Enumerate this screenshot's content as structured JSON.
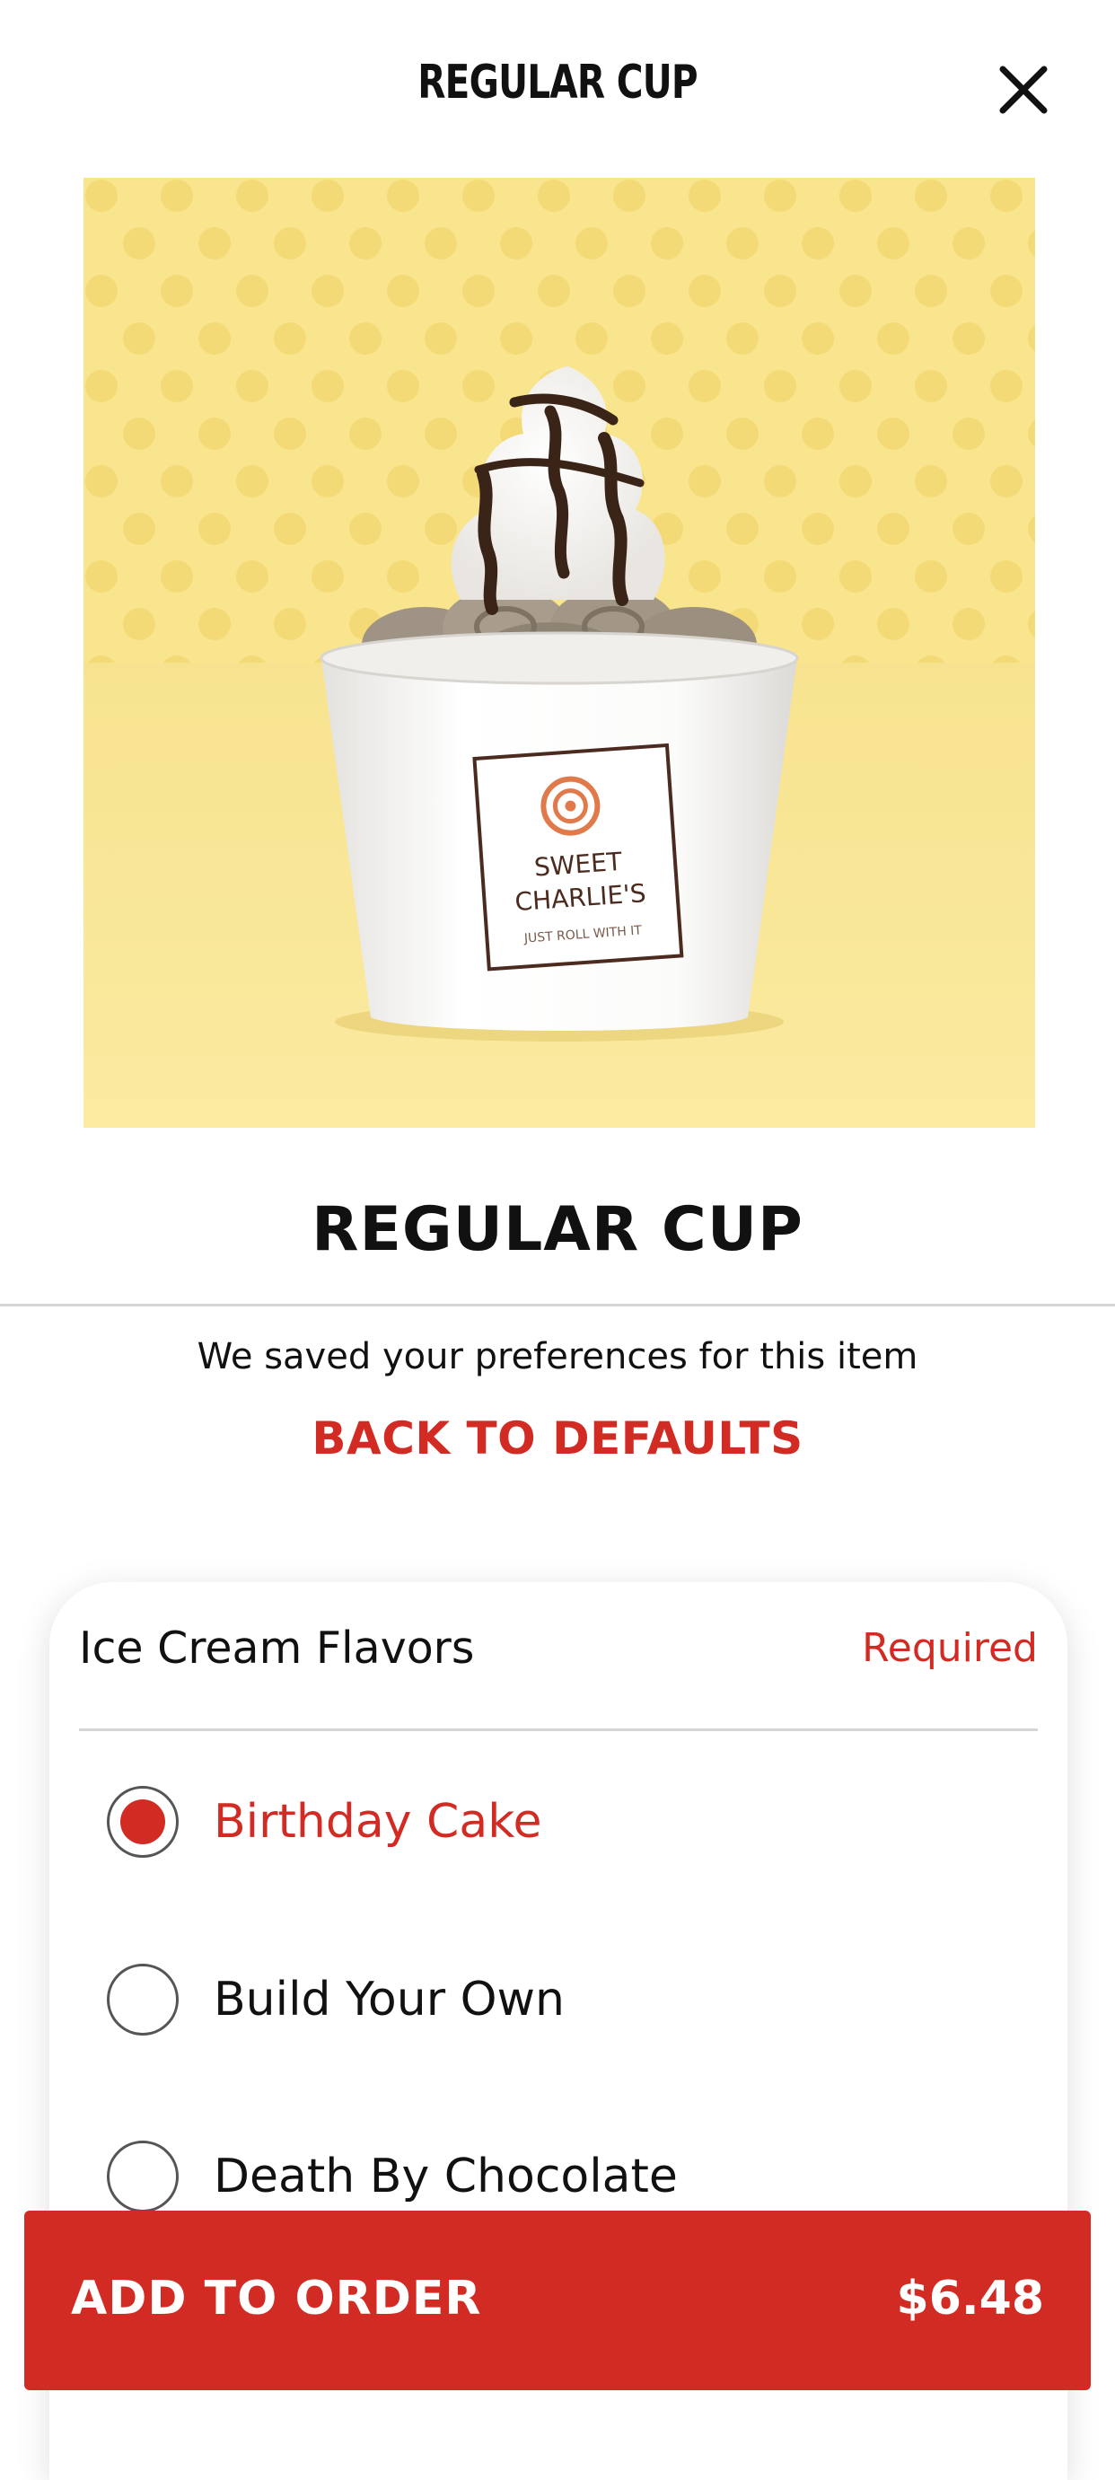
{
  "header": {
    "title": "REGULAR CUP",
    "close_icon": "close-icon"
  },
  "hero": {
    "brand_line1": "SWEET",
    "brand_line2": "CHARLIE'S",
    "tagline": "JUST ROLL WITH IT",
    "background_color": "#f8e58e"
  },
  "product": {
    "title": "REGULAR CUP",
    "saved_note": "We saved your preferences for this item",
    "defaults_link": "BACK TO DEFAULTS"
  },
  "options_card": {
    "title": "Ice Cream Flavors",
    "required": "Required",
    "options": [
      {
        "label": "Birthday Cake",
        "selected": true
      },
      {
        "label": "Build Your Own",
        "selected": false
      },
      {
        "label": "Death By Chocolate",
        "selected": false
      }
    ]
  },
  "footer": {
    "add_label": "ADD TO ORDER",
    "price": "$6.48"
  },
  "colors": {
    "accent": "#d22b23",
    "divider": "#d6d6d6"
  }
}
